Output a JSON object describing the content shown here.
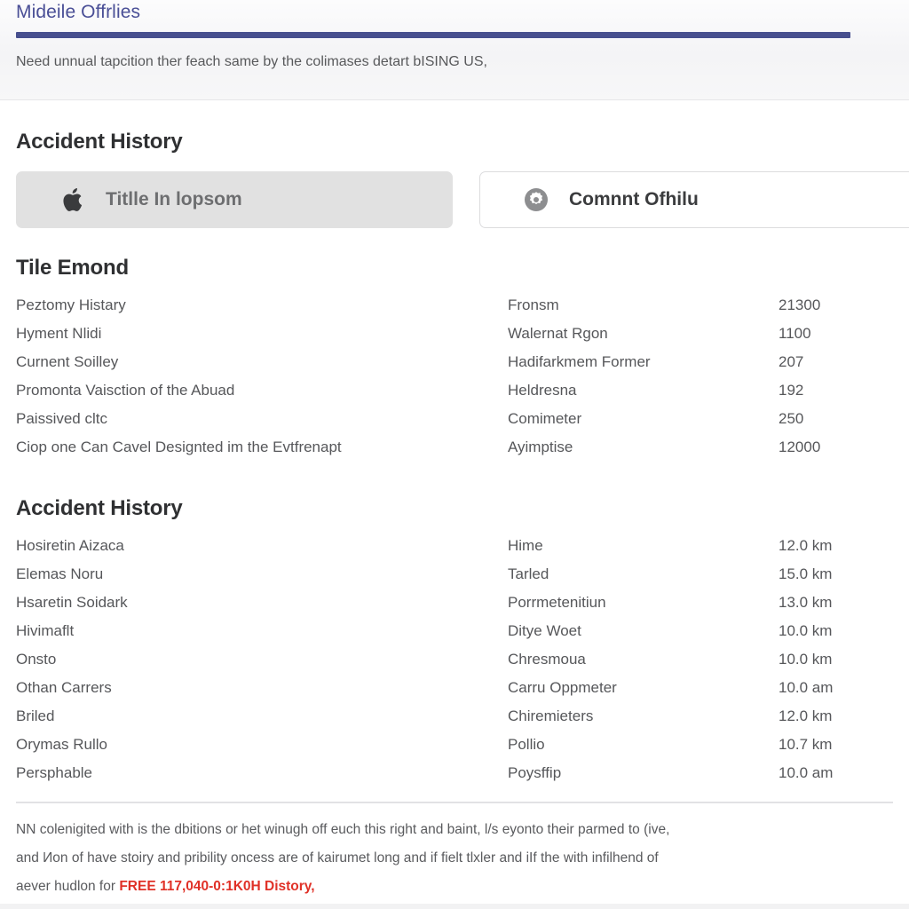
{
  "header": {
    "title": "Mideile Offrlies",
    "subtitle": "Need unnual tapcition ther feach same by the colimases detart bISING US,",
    "accent_color": "#474f8e",
    "title_color": "#4a4f96"
  },
  "tabs": [
    {
      "label": "Titlle In lopsom",
      "icon": "apple-logo-icon",
      "selected": true
    },
    {
      "label": "Comnnt Ofhilu",
      "icon": "gear-circle-icon",
      "selected": false
    }
  ],
  "sections": [
    {
      "heading": "Accident History",
      "title_above_tabs": true
    },
    {
      "heading": "Tile Emond",
      "left_items": [
        "Peztomy Histary",
        "Hyment Nlidi",
        "Curnent Soilley",
        "Promonta Vaisction of the Abuad",
        "Paissived cltc",
        "Ciop one Can Cavel Designted im the Evtfrenapt"
      ],
      "right_rows": [
        {
          "label": "Fronsm",
          "value": "21300"
        },
        {
          "label": "Walernat Rgon",
          "value": "1100"
        },
        {
          "label": "Hadifarkmem Former",
          "value": "207"
        },
        {
          "label": "Heldresna",
          "value": "192"
        },
        {
          "label": "Comimeter",
          "value": "250"
        },
        {
          "label": "Ayimptise",
          "value": "12000"
        }
      ]
    },
    {
      "heading": "Accident History",
      "left_items": [
        "Hosiretin Aizaca",
        "Elemas Noru",
        "Hsaretin Soidark",
        "Hivimaflt",
        "Onsto",
        "Othan Carrers",
        "Briled",
        "Orymas Rullo",
        "Persphable"
      ],
      "right_rows": [
        {
          "label": "Hime",
          "value": "12.0 km"
        },
        {
          "label": "Tarled",
          "value": "15.0 km"
        },
        {
          "label": "Porrmetenitiun",
          "value": "13.0 km"
        },
        {
          "label": "Ditye Woet",
          "value": "10.0 km"
        },
        {
          "label": "Chresmoua",
          "value": "10.0 km"
        },
        {
          "label": "Carru Oppmeter",
          "value": "10.0 am"
        },
        {
          "label": "Chiremieters",
          "value": "12.0 km"
        },
        {
          "label": "Pollio",
          "value": "10.7 km"
        },
        {
          "label": "Poysffip",
          "value": "10.0 am"
        }
      ]
    }
  ],
  "footer": {
    "line1": "NN colenigited with is the dbitions or het winugh off euch this right and baint, l/s eyonto their parmed to (ive,",
    "line2": "and Иon of have stoiry and pribility oncess are of kairumet long and if fielt tlxler and iIf the with infilhend of",
    "line3_prefix": "aever hudlon for ",
    "line3_highlight": "FREE 117,040-0:1K0H Distory,",
    "highlight_color": "#e03127"
  }
}
